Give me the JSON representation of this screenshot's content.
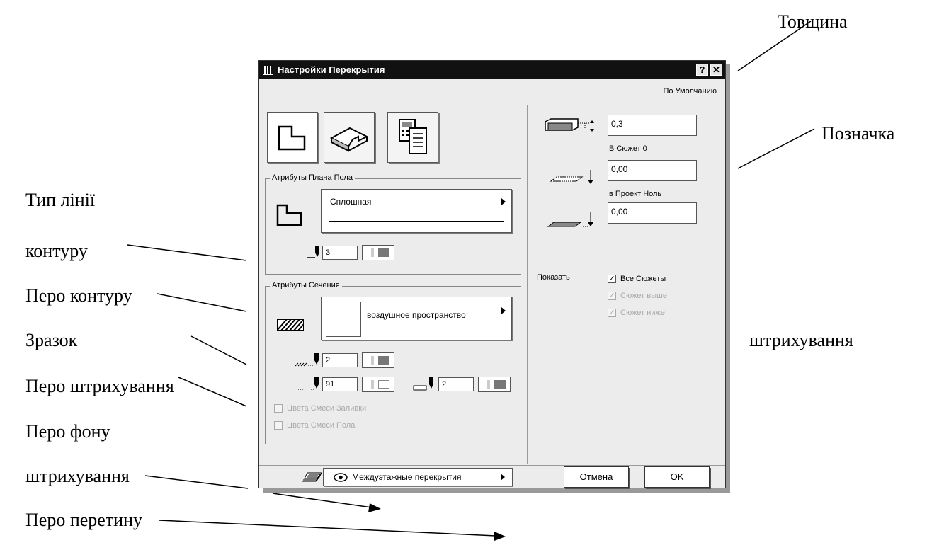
{
  "dialog": {
    "title": "Настройки Перекрытия",
    "help_label": "?",
    "close_label": "✕",
    "defaults_label": "По Умолчанию"
  },
  "floor_plan": {
    "group_label": "Атрибуты Плана Пола",
    "line_type": "Сплошная",
    "pen": "3"
  },
  "section": {
    "group_label": "Атрибуты Сечения",
    "fill_name": "воздушное пространство",
    "hatch_pen": "2",
    "bg_pen": "91",
    "cut_pen": "2",
    "mix_fill_label": "Цвета Смеси Заливки",
    "mix_floor_label": "Цвета Смеси Пола"
  },
  "geometry": {
    "thickness": "0,3",
    "story_label": "В Сюжет 0",
    "story_offset": "0,00",
    "project_label": "в Проект Ноль",
    "project_offset": "0,00"
  },
  "show": {
    "label": "Показать",
    "all_stories": "Все Сюжеты",
    "story_above": "Сюжет выше",
    "story_below": "Сюжет ниже"
  },
  "footer": {
    "layer": "Междуэтажные перекрытия",
    "cancel": "Отмена",
    "ok": "OK"
  },
  "annotations": {
    "thickness": "Товщина",
    "marker": "Позначка",
    "line_type_1": "Тип лінії",
    "line_type_2": "контуру",
    "contour_pen": "Перо контуру",
    "sample": "Зразок",
    "hatch_pen": "Перо штрихування",
    "hatch_bg_pen_1": "Перо фону",
    "hatch_bg_pen_2": "штрихування",
    "intersection_pen": "Перо перетину",
    "right_hatch": "штрихування"
  }
}
